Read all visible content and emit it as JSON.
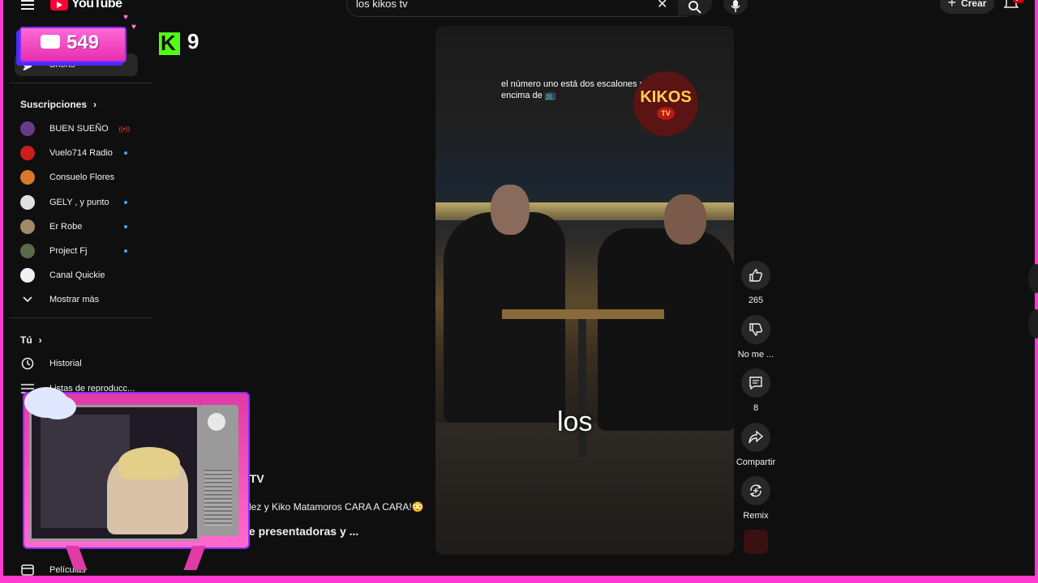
{
  "header": {
    "logo_text": "YouTube",
    "search_value": "los kikos tv",
    "create_label": "Crear",
    "notification_badge": "9+"
  },
  "overlay": {
    "chat_count": "549",
    "kick_letter": "K",
    "kick_count": "9"
  },
  "sidebar": {
    "shorts_label": "Shorts",
    "subscriptions_heading": "Suscripciones",
    "subscriptions": [
      {
        "name": "BUEN SUEÑO",
        "status": "live",
        "color": "#6a3a8a"
      },
      {
        "name": "Vuelo714 Radio",
        "status": "new",
        "color": "#c81e1e"
      },
      {
        "name": "Consuelo Flores",
        "status": "none",
        "color": "#d9782a"
      },
      {
        "name": "GELY , y punto",
        "status": "new",
        "color": "#e0e0e0"
      },
      {
        "name": "Er Robe",
        "status": "new",
        "color": "#a08a6a"
      },
      {
        "name": "Project Fj",
        "status": "new",
        "color": "#5a6a4a"
      },
      {
        "name": "Canal Quickie",
        "status": "none",
        "color": "#f1f1f1"
      }
    ],
    "show_more_label": "Mostrar más",
    "you_heading": "Tú",
    "history_label": "Historial",
    "playlists_label": "Listas de reproducc...",
    "movies_label": "Películas"
  },
  "background_results": {
    "channel_fragment": "sTV",
    "title_fragment_1": "dez y Kiko Matamoros CARA A CARA!😳",
    "title_fragment_2": "le presentadoras y ..."
  },
  "short": {
    "caption_text": "el número uno está dos escalones por encima de",
    "caption_emoji": "📺",
    "logo_text": "KIKOS",
    "logo_sub": "TV",
    "subtitle": "los"
  },
  "actions": {
    "like_count": "265",
    "dislike_label": "No me ...",
    "comments_count": "8",
    "share_label": "Compartir",
    "remix_label": "Remix"
  },
  "colors": {
    "background": "#0f0f0f",
    "accent_red": "#ff0033",
    "overlay_pink": "#ff3ad0",
    "kick_green": "#53fc18"
  }
}
